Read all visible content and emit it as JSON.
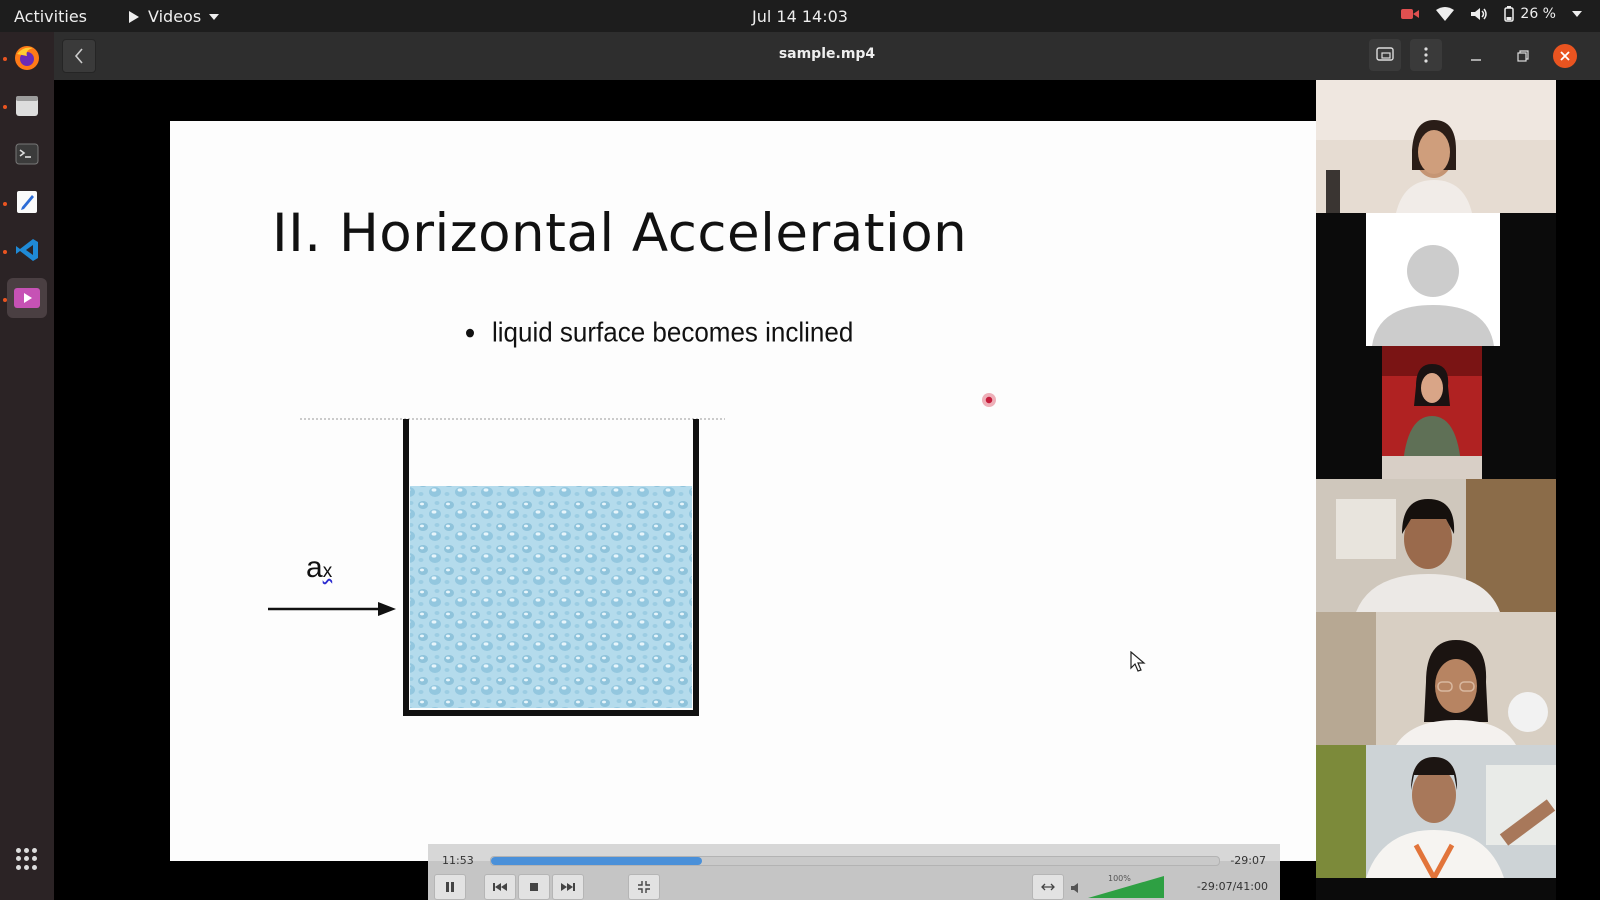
{
  "topbar": {
    "activities": "Activities",
    "app_name": "Videos",
    "clock": "Jul 14  14:03",
    "battery": "26 %"
  },
  "dock": {
    "items": [
      {
        "name": "firefox",
        "icon": "firefox-icon"
      },
      {
        "name": "files",
        "icon": "files-icon"
      },
      {
        "name": "terminal",
        "icon": "terminal-icon"
      },
      {
        "name": "text-editor",
        "icon": "text-editor-icon"
      },
      {
        "name": "vscode",
        "icon": "vscode-icon"
      },
      {
        "name": "videos",
        "icon": "videos-icon"
      }
    ]
  },
  "window": {
    "title": "sample.mp4"
  },
  "slide": {
    "title": "II. Horizontal Acceleration",
    "bullet": "liquid surface becomes inclined",
    "label_main": "a",
    "label_sub": "x"
  },
  "player": {
    "elapsed": "11:53",
    "remaining": "-29:07",
    "progress": 0.29,
    "volume_label": "100%",
    "total": "-29:07/41:00"
  },
  "colors": {
    "accent": "#e95420",
    "seek_fill": "#4a90d9",
    "water": "#a9d4e8"
  }
}
